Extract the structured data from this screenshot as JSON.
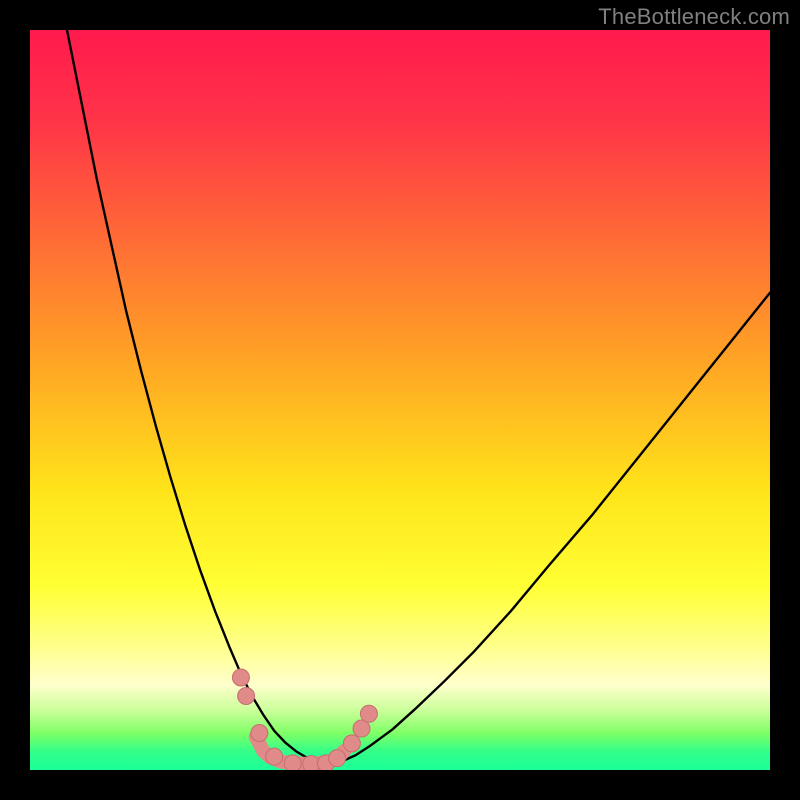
{
  "watermark": "TheBottleneck.com",
  "colors": {
    "black": "#000000",
    "curve": "#000000",
    "marker_fill": "#e08a8a",
    "marker_stroke": "#c46e6e",
    "gradient_stops": [
      {
        "offset": 0.0,
        "color": "#ff1a4d"
      },
      {
        "offset": 0.12,
        "color": "#ff3348"
      },
      {
        "offset": 0.28,
        "color": "#ff6a36"
      },
      {
        "offset": 0.45,
        "color": "#ffa524"
      },
      {
        "offset": 0.62,
        "color": "#ffe31a"
      },
      {
        "offset": 0.75,
        "color": "#ffff33"
      },
      {
        "offset": 0.83,
        "color": "#ffff88"
      },
      {
        "offset": 0.885,
        "color": "#ffffcc"
      },
      {
        "offset": 0.92,
        "color": "#c9ff99"
      },
      {
        "offset": 0.95,
        "color": "#7fff66"
      },
      {
        "offset": 0.975,
        "color": "#33ff88"
      },
      {
        "offset": 1.0,
        "color": "#1aff99"
      }
    ]
  },
  "chart_data": {
    "type": "line",
    "title": "",
    "xlabel": "",
    "ylabel": "",
    "xlim": [
      0,
      100
    ],
    "ylim": [
      0,
      100
    ],
    "series": [
      {
        "name": "left-curve",
        "x": [
          5,
          7,
          9,
          11,
          13,
          15,
          17,
          19,
          21,
          23,
          25,
          27,
          28.5,
          30,
          31.5,
          33,
          34.5,
          36,
          37.5,
          39,
          40.5
        ],
        "y": [
          100,
          90,
          80,
          71,
          62,
          54,
          46.5,
          39.5,
          33,
          27,
          21.5,
          16.5,
          13,
          10,
          7.5,
          5.3,
          3.7,
          2.5,
          1.6,
          1.0,
          0.7
        ]
      },
      {
        "name": "right-curve",
        "x": [
          40.5,
          42,
          44,
          46,
          49,
          52,
          56,
          60,
          65,
          70,
          76,
          82,
          88,
          94,
          100
        ],
        "y": [
          0.7,
          1.1,
          2.0,
          3.3,
          5.5,
          8.2,
          12.0,
          16.0,
          21.5,
          27.5,
          34.5,
          42.0,
          49.5,
          57.0,
          64.5
        ]
      }
    ],
    "markers": [
      {
        "x": 28.5,
        "y": 12.5
      },
      {
        "x": 29.2,
        "y": 10.0
      },
      {
        "x": 31.0,
        "y": 5.0
      },
      {
        "x": 33.0,
        "y": 1.8
      },
      {
        "x": 35.5,
        "y": 0.9
      },
      {
        "x": 38.0,
        "y": 0.8
      },
      {
        "x": 40.0,
        "y": 0.9
      },
      {
        "x": 41.5,
        "y": 1.6
      },
      {
        "x": 43.5,
        "y": 3.6
      },
      {
        "x": 44.8,
        "y": 5.6
      },
      {
        "x": 45.8,
        "y": 7.6
      }
    ],
    "bottom_path": {
      "x": [
        30.5,
        31.5,
        32.5,
        34.0,
        36.0,
        38.0,
        40.0,
        41.5,
        42.5
      ],
      "y": [
        4.5,
        2.6,
        1.7,
        1.1,
        0.85,
        0.85,
        1.0,
        1.5,
        2.6
      ]
    }
  }
}
